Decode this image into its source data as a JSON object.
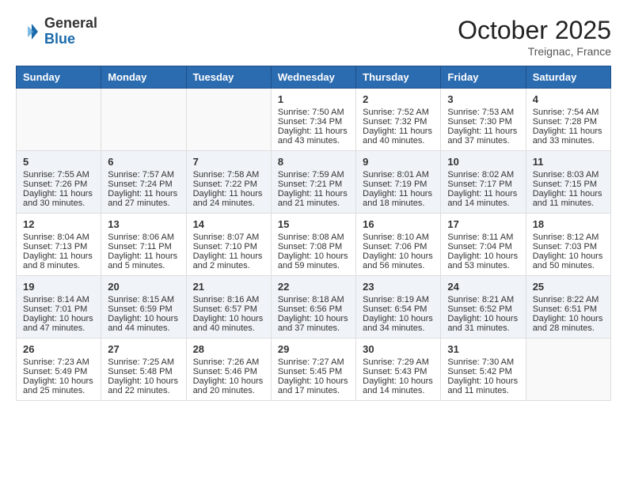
{
  "header": {
    "logo_general": "General",
    "logo_blue": "Blue",
    "month": "October 2025",
    "location": "Treignac, France"
  },
  "days_of_week": [
    "Sunday",
    "Monday",
    "Tuesday",
    "Wednesday",
    "Thursday",
    "Friday",
    "Saturday"
  ],
  "weeks": [
    {
      "style": "white",
      "days": [
        {
          "num": "",
          "info": ""
        },
        {
          "num": "",
          "info": ""
        },
        {
          "num": "",
          "info": ""
        },
        {
          "num": "1",
          "info": "Sunrise: 7:50 AM\nSunset: 7:34 PM\nDaylight: 11 hours and 43 minutes."
        },
        {
          "num": "2",
          "info": "Sunrise: 7:52 AM\nSunset: 7:32 PM\nDaylight: 11 hours and 40 minutes."
        },
        {
          "num": "3",
          "info": "Sunrise: 7:53 AM\nSunset: 7:30 PM\nDaylight: 11 hours and 37 minutes."
        },
        {
          "num": "4",
          "info": "Sunrise: 7:54 AM\nSunset: 7:28 PM\nDaylight: 11 hours and 33 minutes."
        }
      ]
    },
    {
      "style": "alt",
      "days": [
        {
          "num": "5",
          "info": "Sunrise: 7:55 AM\nSunset: 7:26 PM\nDaylight: 11 hours and 30 minutes."
        },
        {
          "num": "6",
          "info": "Sunrise: 7:57 AM\nSunset: 7:24 PM\nDaylight: 11 hours and 27 minutes."
        },
        {
          "num": "7",
          "info": "Sunrise: 7:58 AM\nSunset: 7:22 PM\nDaylight: 11 hours and 24 minutes."
        },
        {
          "num": "8",
          "info": "Sunrise: 7:59 AM\nSunset: 7:21 PM\nDaylight: 11 hours and 21 minutes."
        },
        {
          "num": "9",
          "info": "Sunrise: 8:01 AM\nSunset: 7:19 PM\nDaylight: 11 hours and 18 minutes."
        },
        {
          "num": "10",
          "info": "Sunrise: 8:02 AM\nSunset: 7:17 PM\nDaylight: 11 hours and 14 minutes."
        },
        {
          "num": "11",
          "info": "Sunrise: 8:03 AM\nSunset: 7:15 PM\nDaylight: 11 hours and 11 minutes."
        }
      ]
    },
    {
      "style": "white",
      "days": [
        {
          "num": "12",
          "info": "Sunrise: 8:04 AM\nSunset: 7:13 PM\nDaylight: 11 hours and 8 minutes."
        },
        {
          "num": "13",
          "info": "Sunrise: 8:06 AM\nSunset: 7:11 PM\nDaylight: 11 hours and 5 minutes."
        },
        {
          "num": "14",
          "info": "Sunrise: 8:07 AM\nSunset: 7:10 PM\nDaylight: 11 hours and 2 minutes."
        },
        {
          "num": "15",
          "info": "Sunrise: 8:08 AM\nSunset: 7:08 PM\nDaylight: 10 hours and 59 minutes."
        },
        {
          "num": "16",
          "info": "Sunrise: 8:10 AM\nSunset: 7:06 PM\nDaylight: 10 hours and 56 minutes."
        },
        {
          "num": "17",
          "info": "Sunrise: 8:11 AM\nSunset: 7:04 PM\nDaylight: 10 hours and 53 minutes."
        },
        {
          "num": "18",
          "info": "Sunrise: 8:12 AM\nSunset: 7:03 PM\nDaylight: 10 hours and 50 minutes."
        }
      ]
    },
    {
      "style": "alt",
      "days": [
        {
          "num": "19",
          "info": "Sunrise: 8:14 AM\nSunset: 7:01 PM\nDaylight: 10 hours and 47 minutes."
        },
        {
          "num": "20",
          "info": "Sunrise: 8:15 AM\nSunset: 6:59 PM\nDaylight: 10 hours and 44 minutes."
        },
        {
          "num": "21",
          "info": "Sunrise: 8:16 AM\nSunset: 6:57 PM\nDaylight: 10 hours and 40 minutes."
        },
        {
          "num": "22",
          "info": "Sunrise: 8:18 AM\nSunset: 6:56 PM\nDaylight: 10 hours and 37 minutes."
        },
        {
          "num": "23",
          "info": "Sunrise: 8:19 AM\nSunset: 6:54 PM\nDaylight: 10 hours and 34 minutes."
        },
        {
          "num": "24",
          "info": "Sunrise: 8:21 AM\nSunset: 6:52 PM\nDaylight: 10 hours and 31 minutes."
        },
        {
          "num": "25",
          "info": "Sunrise: 8:22 AM\nSunset: 6:51 PM\nDaylight: 10 hours and 28 minutes."
        }
      ]
    },
    {
      "style": "white",
      "days": [
        {
          "num": "26",
          "info": "Sunrise: 7:23 AM\nSunset: 5:49 PM\nDaylight: 10 hours and 25 minutes."
        },
        {
          "num": "27",
          "info": "Sunrise: 7:25 AM\nSunset: 5:48 PM\nDaylight: 10 hours and 22 minutes."
        },
        {
          "num": "28",
          "info": "Sunrise: 7:26 AM\nSunset: 5:46 PM\nDaylight: 10 hours and 20 minutes."
        },
        {
          "num": "29",
          "info": "Sunrise: 7:27 AM\nSunset: 5:45 PM\nDaylight: 10 hours and 17 minutes."
        },
        {
          "num": "30",
          "info": "Sunrise: 7:29 AM\nSunset: 5:43 PM\nDaylight: 10 hours and 14 minutes."
        },
        {
          "num": "31",
          "info": "Sunrise: 7:30 AM\nSunset: 5:42 PM\nDaylight: 10 hours and 11 minutes."
        },
        {
          "num": "",
          "info": ""
        }
      ]
    }
  ]
}
